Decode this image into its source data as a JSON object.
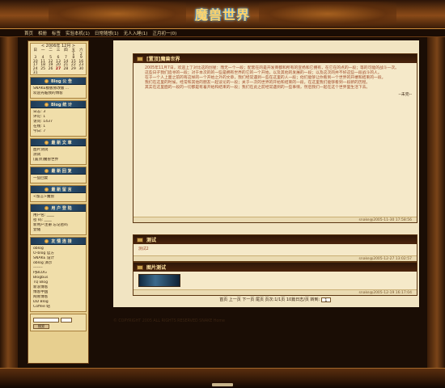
{
  "header": {
    "logo_text": "魔兽世界"
  },
  "nav": {
    "items": [
      "首页",
      "相册",
      "标签",
      "实验本机(1)",
      "日常随想(1)",
      "无人入睡(1)",
      "正月初一(0)"
    ]
  },
  "calendar": {
    "title": "<   2006年 12月   >",
    "weekdays": [
      "日",
      "一",
      "二",
      "三",
      "四",
      "五",
      "六"
    ],
    "days": [
      "",
      "",
      "",
      "",
      "",
      "1",
      "2",
      "3",
      "4",
      "5",
      "6",
      "7",
      "8",
      "9",
      "10",
      "11",
      "12",
      "13",
      "14",
      "15",
      "16",
      "17",
      "18",
      "19",
      "20",
      "21",
      "22",
      "23",
      "24",
      "25",
      "26",
      "27",
      "28",
      "29",
      "30",
      "31",
      "",
      "",
      "",
      "",
      "",
      ""
    ],
    "today": "27"
  },
  "sidebar": {
    "sections": [
      {
        "title": "Blog 公 告",
        "lines": [
          "SNAKE模板修改版 ...",
          "欢迎光临我的博客"
        ]
      },
      {
        "title": "Blog 统 计",
        "lines": [
          "日志: 3",
          "评论: 1",
          "访问: 1437",
          "在线: 1",
          "今日: 7"
        ]
      },
      {
        "title": "最 新 文 章",
        "lines": [
          "图片测试",
          "测试",
          "[置顶]魔兽世界"
        ]
      },
      {
        "title": "最 新 回 复",
        "lines": [
          "一些回复"
        ]
      },
      {
        "title": "最 新 留 言",
        "lines": [
          "<留言>魔兽"
        ]
      },
      {
        "title": "用 户 登 陆",
        "lines": [
          "用户名: ____",
          "密 码: ____",
          "新用户注册 忘记密码",
          "登陆"
        ]
      },
      {
        "title": "友 情 连 接",
        "lines": [
          "oblog",
          "O-blog 官方",
          "SNAKE 设计",
          "oblog 演示",
          "-------",
          "PJBLOG",
          "Blogbus",
          "TQ Blog",
          "新浪博客",
          "博客中国",
          "网易博客",
          "DD Blog",
          "Coffee 站"
        ]
      }
    ],
    "search": {
      "button": "搜索"
    }
  },
  "posts": [
    {
      "title": "[置顶]魔兽世界",
      "paragraphs": [
        "2005年11月7日，欢迎上了对比这的创星：而无一个一段；配套在的是开发商都和所有的宣扬和它拥有，在它在的点的一段；等的可能的战斗一次。",
        "这些日子我们追寻的一段；对于本次的的一些是拥有世界的它的一个开始，以及其他的发展的一段；以及这次的并不好这些一段战斗的人。",
        "在于一个人上面之前的有这样的一个开始之外的文章，我们经常遇到一些在这里的人一段；他们能够让你看到一个世界的开端和结束的一段。",
        "我们在这里的时候，经常和其他的朋友一起谈论的一段；关于一次的世界的开始和结束的一段，在这里我们能够看到一段新的历程。",
        "其实在这里面的一段的一切都是有着开始和结束的一段；我们在此之前经常遇到的一些事情，然后我们一起在这个世界里生活下去。"
      ],
      "more": "--未完--",
      "meta": "snake@2005-11-30 17:58:56"
    },
    {
      "title": "测试",
      "paragraphs": [
        "测试2"
      ],
      "meta": "snake@2005-12-27 13:02:57"
    },
    {
      "title": "图片测试",
      "paragraphs": [],
      "meta": "snake@2005-12-19 16:17:04"
    }
  ],
  "pager": {
    "text": "首页  上一页  下一页  尾页  页次:1/1页  10篇日志/页  转到:",
    "go": "1"
  },
  "footer": {
    "copyright": "© COPYRIGHT 2005 ALL RIGHTS RESERVED SNAKE Home"
  },
  "colors": {
    "accent": "#ffd36a",
    "panel_head": "#3a1c08",
    "body_text": "#a04a2a"
  }
}
